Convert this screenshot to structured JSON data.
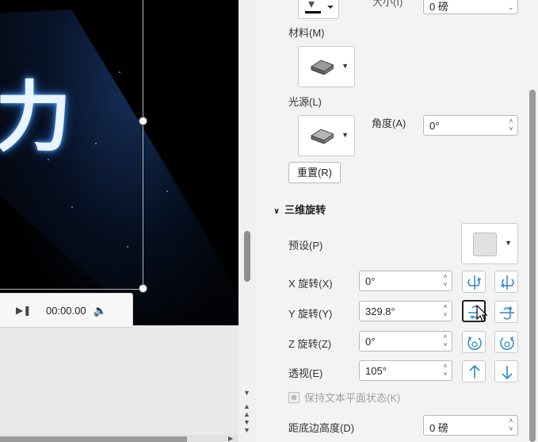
{
  "slide": {
    "title_glyph": "力",
    "media_time": "00:00.00"
  },
  "pane": {
    "top_partial_label": "大小(I)",
    "size_value": "0 磅",
    "material_label": "材料(M)",
    "lighting_label": "光源(L)",
    "angle_label": "角度(A)",
    "angle_value": "0°",
    "reset_label": "重置(R)",
    "section_title": "三维旋转",
    "preset_label": "预设(P)",
    "x_rotation_label": "X 旋转(X)",
    "x_rotation_value": "0°",
    "y_rotation_label": "Y 旋转(Y)",
    "y_rotation_value": "329.8°",
    "z_rotation_label": "Z 旋转(Z)",
    "z_rotation_value": "0°",
    "perspective_label": "透视(E)",
    "perspective_value": "105°",
    "keep_text_flat_label": "保持文本平面状态(K)",
    "distance_label": "距底边高度(D)",
    "distance_value": "0 磅"
  },
  "colors": {
    "accent_icon": "#2f86c8",
    "slide_bg": "#000000"
  }
}
